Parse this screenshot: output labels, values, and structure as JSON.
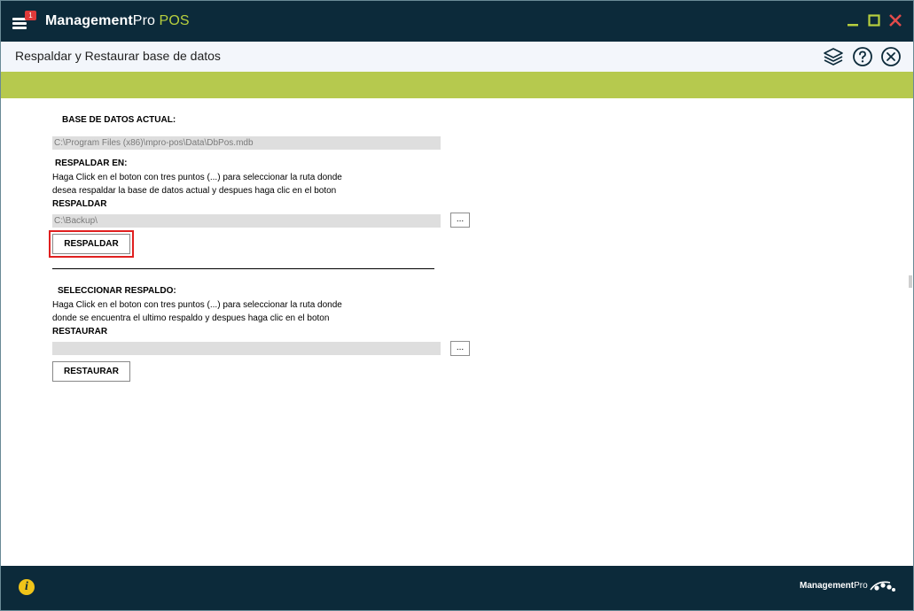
{
  "app": {
    "title_bold": "Management",
    "title_regular": "Pro",
    "title_accent": "POS",
    "menu_badge": "1"
  },
  "page": {
    "title": "Respaldar y Restaurar base de datos"
  },
  "current_db": {
    "label": "BASE DE DATOS ACTUAL:",
    "path": "C:\\Program Files (x86)\\mpro-pos\\Data\\DbPos.mdb"
  },
  "backup": {
    "label": "RESPALDAR EN:",
    "instructions_1": "Haga Click en el boton con tres puntos (...) para seleccionar la ruta donde",
    "instructions_2": "desea respaldar la base de datos actual y despues haga clic en el boton",
    "instructions_3": "RESPALDAR",
    "path": "C:\\Backup\\",
    "browse_label": "...",
    "button_label": "RESPALDAR"
  },
  "restore": {
    "label": "SELECCIONAR RESPALDO:",
    "instructions_1": "Haga Click en el boton con tres puntos (...) para seleccionar la ruta donde",
    "instructions_2": "donde se encuentra el ultimo respaldo y despues haga clic en el boton",
    "instructions_3": "RESTAURAR",
    "path": "",
    "browse_label": "...",
    "button_label": "RESTAURAR"
  },
  "footer": {
    "logo_bold": "Management",
    "logo_regular": "Pro"
  },
  "icons": {
    "menu": "hamburger-icon",
    "minimize": "minimize-icon",
    "maximize": "maximize-icon",
    "close": "close-icon",
    "layers": "layers-icon",
    "help": "help-icon",
    "close_circle": "close-circle-icon",
    "info": "info-icon"
  },
  "colors": {
    "titlebar": "#0c2a3a",
    "accent_green": "#b6c94e",
    "pos_text": "#b7cf3e",
    "highlight": "#e02020",
    "badge": "#e03a3a"
  }
}
